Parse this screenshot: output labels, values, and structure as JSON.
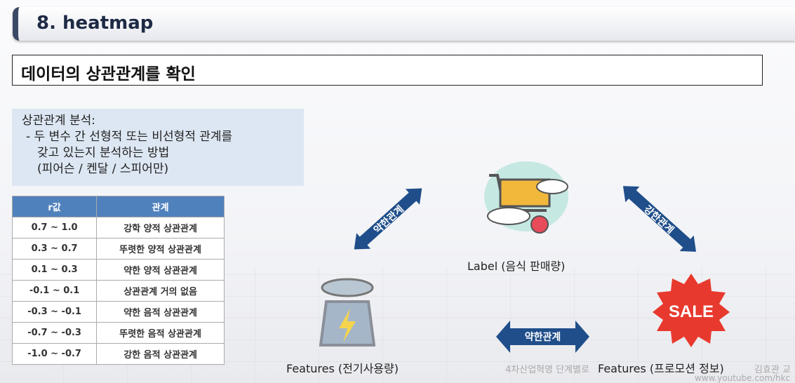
{
  "title": "8. heatmap",
  "subtitle": "데이터의 상관관계를 확인",
  "note": {
    "heading": "상관관계 분석:",
    "lines": [
      "- 두 변수 간 선형적 또는 비선형적 관계를",
      "  갖고 있는지 분석하는 방법",
      "  (피어슨 / 켄달 / 스피어만)"
    ]
  },
  "table": {
    "headers": [
      "r값",
      "관계"
    ],
    "rows": [
      [
        "0.7 ~ 1.0",
        "강학 양적 상관관계"
      ],
      [
        "0.3 ~ 0.7",
        "뚜렷한 양적 상관관계"
      ],
      [
        "0.1 ~ 0.3",
        "약한 양적 상관관계"
      ],
      [
        "-0.1 ~ 0.1",
        "상관관계 거의 없음"
      ],
      [
        "-0.3 ~ -0.1",
        "약한 음적 상관관계"
      ],
      [
        "-0.7  ~ -0.3",
        "뚜렷한 음적 상관관계"
      ],
      [
        "-1.0 ~ -0.7",
        "강한 음적 상관관계"
      ]
    ]
  },
  "diagram": {
    "label": "Label (음식 판매량)",
    "feature_left": "Features (전기사용량)",
    "feature_right": "Features (프로모션 정보)",
    "arrow_left": "약한관계",
    "arrow_right": "강한관계",
    "arrow_bottom": "약한관계",
    "sale": "SALE"
  },
  "watermark": {
    "text": "4차산업혁명 단계별로",
    "author": "김효관 교",
    "url": "www.youtube.com/hkc"
  },
  "colors": {
    "arrow": "#1f4e8a",
    "header": "#4f81bd",
    "sale": "#e8392e"
  }
}
